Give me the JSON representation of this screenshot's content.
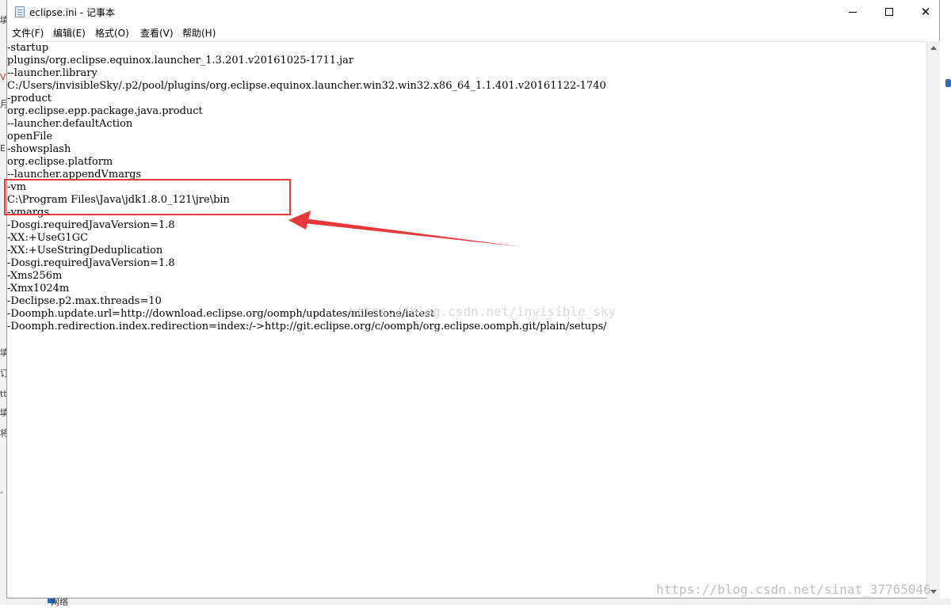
{
  "window": {
    "title": "eclipse.ini - 记事本",
    "controls": {
      "minimize": "minimize-icon",
      "maximize": "maximize-icon",
      "close": "✕"
    }
  },
  "menu": [
    "文件(F)",
    "编辑(E)",
    "格式(O)",
    "查看(V)",
    "帮助(H)"
  ],
  "editor": {
    "lines": [
      "-startup",
      "plugins/org.eclipse.equinox.launcher_1.3.201.v20161025-1711.jar",
      "--launcher.library",
      "C:/Users/invisibleSky/.p2/pool/plugins/org.eclipse.equinox.launcher.win32.win32.x86_64_1.1.401.v20161122-1740",
      "-product",
      "org.eclipse.epp.package.java.product",
      "--launcher.defaultAction",
      "openFile",
      "-showsplash",
      "org.eclipse.platform",
      "--launcher.appendVmargs",
      "-vm",
      "C:\\Program Files\\Java\\jdk1.8.0_121\\jre\\bin",
      "-vmargs",
      "-Dosgi.requiredJavaVersion=1.8",
      "-XX:+UseG1GC",
      "-XX:+UseStringDeduplication",
      "-Dosgi.requiredJavaVersion=1.8",
      "-Xms256m",
      "-Xmx1024m",
      "-Declipse.p2.max.threads=10",
      "-Doomph.update.url=http://download.eclipse.org/oomph/updates/milestone/latest",
      "-Doomph.redirection.index.redirection=index:/->http://git.eclipse.org/c/oomph/org.eclipse.oomph.git/plain/setups/"
    ]
  },
  "watermarks": {
    "middle": "https://blog.csdn.net/invisible_sky",
    "bottom": "https://blog.csdn.net/sinat_37765046"
  },
  "background": {
    "left_fragments": [
      "填",
      "V",
      "月",
      "E",
      "填",
      "订",
      "tt",
      "填",
      "将",
      "-"
    ],
    "bottom_label": "网络"
  },
  "colors": {
    "annotation": "#e8383a",
    "watermark": "#c8c8c8"
  }
}
